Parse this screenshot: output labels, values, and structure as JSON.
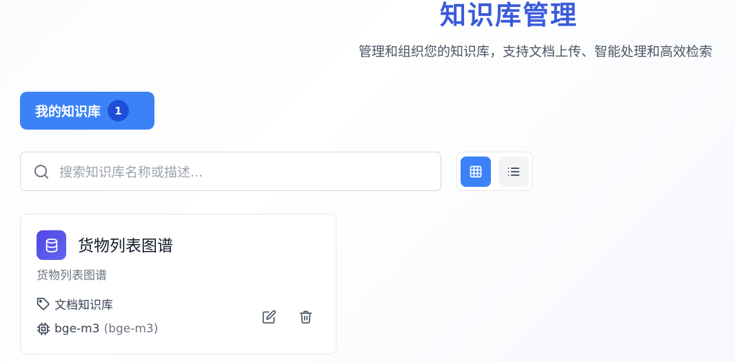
{
  "header": {
    "title": "知识库管理",
    "subtitle": "管理和组织您的知识库，支持文档上传、智能处理和高效检索"
  },
  "tabs": [
    {
      "label": "我的知识库",
      "count": "1",
      "active": true
    }
  ],
  "search": {
    "placeholder": "搜索知识库名称或描述...",
    "value": ""
  },
  "view_toggle": {
    "options": [
      "grid",
      "list"
    ],
    "selected": "grid"
  },
  "knowledge_bases": [
    {
      "name": "货物列表图谱",
      "description": "货物列表图谱",
      "type": "文档知识库",
      "model": "bge-m3",
      "model_detail": "(bge-m3)"
    }
  ],
  "icons": {
    "search": "search-icon",
    "grid": "grid-icon",
    "list": "list-icon",
    "database": "database-icon",
    "tag": "tag-icon",
    "chip": "chip-icon",
    "edit": "edit-icon",
    "delete": "trash-icon"
  },
  "colors": {
    "accent": "#3b82f6",
    "title": "#3b5bdb",
    "badge": "#1d4ed8",
    "avatar": "#4f46e5"
  }
}
